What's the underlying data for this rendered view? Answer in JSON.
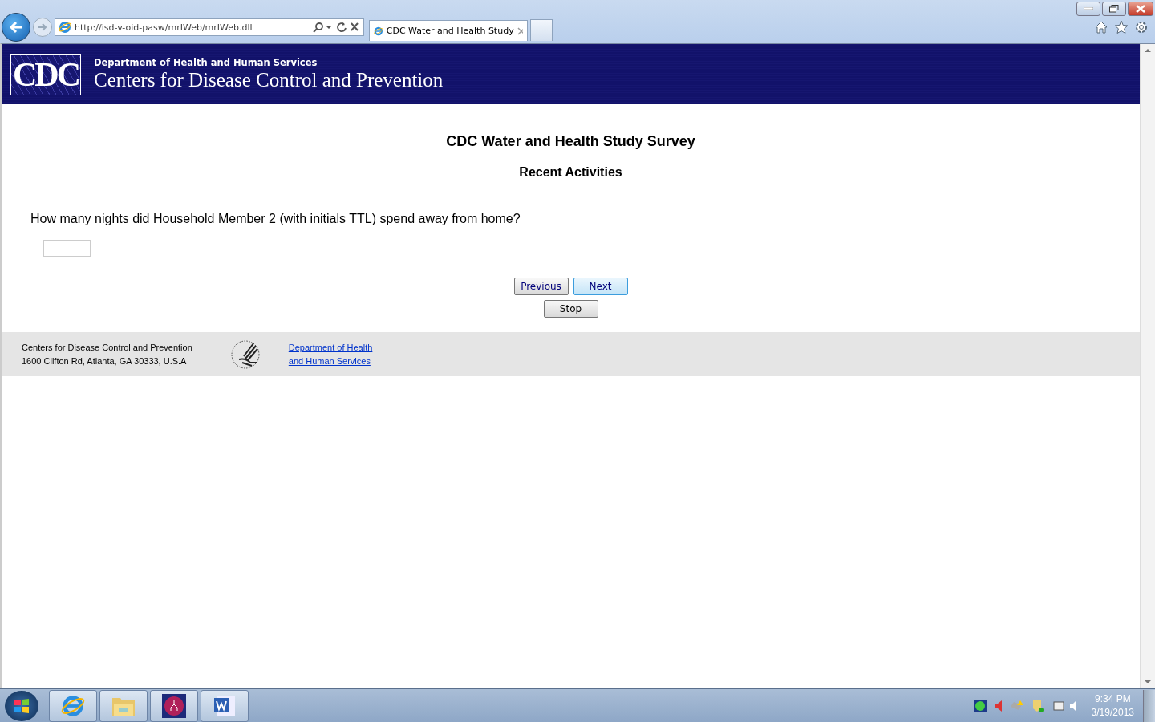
{
  "browser": {
    "address": "http://isd-v-oid-pasw/mrIWeb/mrIWeb.dll",
    "tabs": [
      {
        "title": "CDC Water and Health Study",
        "selected": true
      }
    ]
  },
  "header": {
    "logo": "CDC",
    "department": "Department of Health and Human Services",
    "agency": "Centers for Disease Control and Prevention"
  },
  "survey": {
    "title": "CDC Water and Health Study Survey",
    "section": "Recent Activities",
    "question": "How many nights did Household Member 2 (with initials TTL) spend away from home?"
  },
  "buttons": [
    {
      "label": "Previous",
      "focused": false
    },
    {
      "label": "Next",
      "focused": true
    }
  ],
  "stop_button": "Stop",
  "footer": {
    "lines": [
      "Centers for Disease Control and Prevention",
      "1600 Clifton Rd, Atlanta, GA 30333, U.S.A"
    ],
    "links": [
      "Department of Health",
      "and Human Services"
    ]
  },
  "taskbar": {
    "time": "9:34 PM",
    "date": "3/19/2013"
  }
}
